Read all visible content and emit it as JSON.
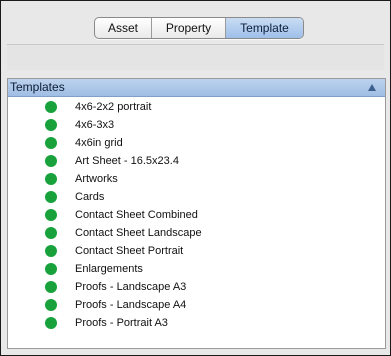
{
  "tabs": [
    {
      "label": "Asset",
      "active": false
    },
    {
      "label": "Property",
      "active": false
    },
    {
      "label": "Template",
      "active": true
    }
  ],
  "list": {
    "header": "Templates",
    "sort_icon": "sort-ascending-triangle-icon",
    "status_icon": "green-dot-icon",
    "status_color": "#19a23c",
    "items": [
      "4x6-2x2 portrait",
      "4x6-3x3",
      "4x6in grid",
      "Art Sheet - 16.5x23.4",
      "Artworks",
      "Cards",
      "Contact Sheet Combined",
      "Contact Sheet Landscape",
      "Contact Sheet Portrait",
      "Enlargements",
      "Proofs - Landscape A3",
      "Proofs - Landscape A4",
      "Proofs - Portrait A3"
    ]
  },
  "colors": {
    "accent": "#9fbde4",
    "status_green": "#19a23c"
  }
}
